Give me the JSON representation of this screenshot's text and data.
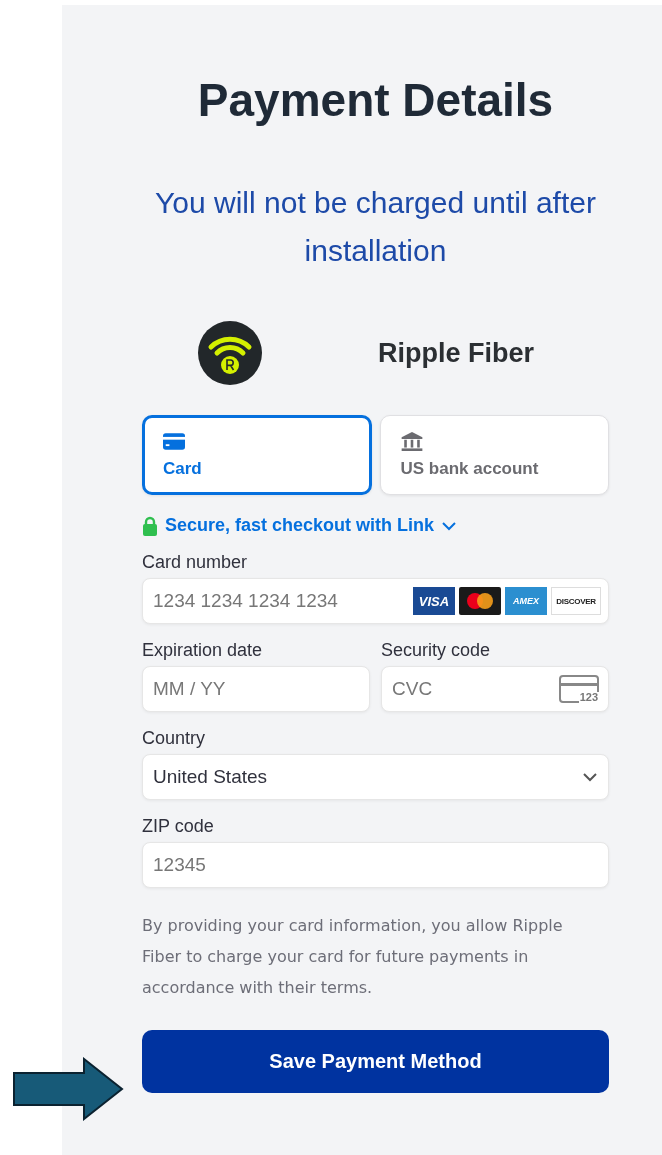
{
  "title": "Payment Details",
  "subtitle": "You will not be charged until after installation",
  "merchant": {
    "name": "Ripple Fiber"
  },
  "tabs": [
    {
      "kind": "card",
      "label": "Card",
      "selected": true
    },
    {
      "kind": "bank",
      "label": "US bank account",
      "selected": false
    }
  ],
  "link_offer": {
    "label": "Secure, fast checkout with Link",
    "expanded": false
  },
  "card_number": {
    "label": "Card number",
    "placeholder": "1234 1234 1234 1234",
    "brands": [
      {
        "kind": "visa",
        "label": "VISA"
      },
      {
        "kind": "mastercard"
      },
      {
        "kind": "amex",
        "label": "AMEX"
      },
      {
        "kind": "discover",
        "label": "DISCOVER"
      }
    ]
  },
  "expiration": {
    "label": "Expiration date",
    "placeholder": "MM / YY"
  },
  "security_code": {
    "label": "Security code",
    "placeholder": "CVC",
    "icon_text": "123"
  },
  "country": {
    "label": "Country",
    "value": "United States"
  },
  "zip": {
    "label": "ZIP code",
    "placeholder": "12345"
  },
  "notice": "By providing your card information, you allow Ripple Fiber to charge your card for future payments in accordance with their terms.",
  "submit": {
    "label": "Save Payment Method"
  }
}
